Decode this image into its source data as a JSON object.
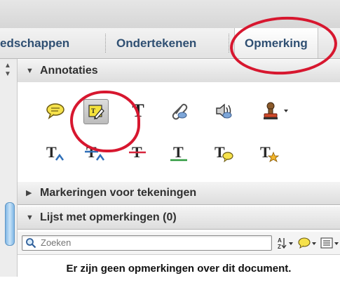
{
  "tabs": [
    {
      "label": "edschappen"
    },
    {
      "label": "Ondertekenen"
    },
    {
      "label": "Opmerking",
      "active": true
    }
  ],
  "panels": {
    "annotaties": "Annotaties",
    "markeringen": "Markeringen voor tekeningen",
    "lijst": "Lijst met opmerkingen (0)"
  },
  "tools": {
    "row1": [
      {
        "name": "sticky-note-icon"
      },
      {
        "name": "highlight-text-icon",
        "selected": true
      },
      {
        "name": "add-text-icon",
        "glyph": "T"
      },
      {
        "name": "attach-file-icon"
      },
      {
        "name": "record-audio-icon"
      },
      {
        "name": "add-stamp-icon"
      }
    ],
    "row2": [
      {
        "name": "insert-text-icon",
        "glyph": "T"
      },
      {
        "name": "replace-text-icon",
        "glyph": "T"
      },
      {
        "name": "strikethrough-icon",
        "glyph": "T"
      },
      {
        "name": "underline-icon",
        "glyph": "T"
      },
      {
        "name": "text-note-icon",
        "glyph": "T"
      },
      {
        "name": "text-correction-icon",
        "glyph": "T"
      }
    ]
  },
  "search": {
    "placeholder": "Zoeken"
  },
  "empty_message": "Er zijn geen opmerkingen over dit document.",
  "colors": {
    "accent_red": "#d7172f",
    "tab_text": "#2f4f72",
    "highlight_yellow": "#f4e23c",
    "scroll_blue": "#7fb7e6"
  }
}
